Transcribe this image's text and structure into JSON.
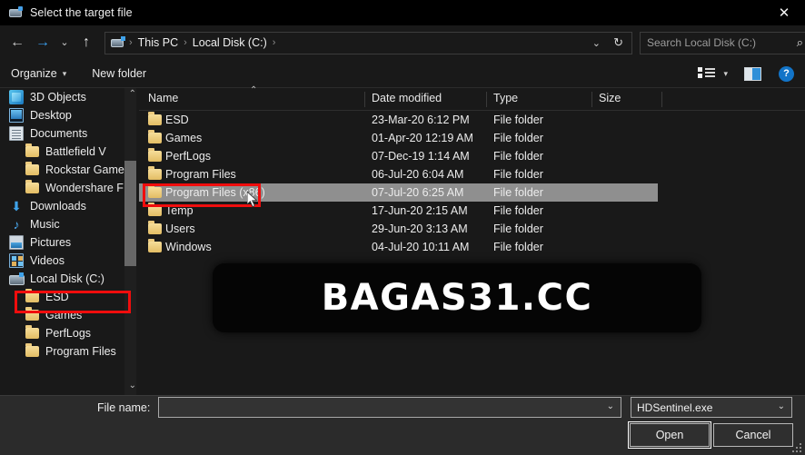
{
  "window": {
    "title": "Select the target file",
    "title_icon": "disk-drive-icon",
    "close_label": "✕"
  },
  "nav": {
    "back_label": "←",
    "forward_label": "→",
    "history_label": "⌄",
    "up_label": "↑",
    "refresh_label": "↻",
    "dropdown_label": "⌄"
  },
  "breadcrumb": {
    "icon": "disk-drive-icon",
    "items": [
      "This PC",
      "Local Disk (C:)"
    ],
    "separator": "›"
  },
  "search": {
    "placeholder": "Search Local Disk (C:)",
    "icon": "search-icon"
  },
  "commandbar": {
    "organize_label": "Organize",
    "organize_caret": "▾",
    "new_folder_label": "New folder",
    "view_caret": "▾",
    "help_label": "?"
  },
  "sidebar": {
    "scroll_up": "⌃",
    "scroll_down": "⌄",
    "items": [
      {
        "label": "3D Objects",
        "icon": "3d-objects-icon",
        "indent": 0,
        "type": "special"
      },
      {
        "label": "Desktop",
        "icon": "desktop-icon",
        "indent": 0,
        "type": "special"
      },
      {
        "label": "Documents",
        "icon": "documents-icon",
        "indent": 0,
        "type": "special"
      },
      {
        "label": "Battlefield V",
        "icon": "folder-icon",
        "indent": 1,
        "type": "folder"
      },
      {
        "label": "Rockstar Game",
        "icon": "folder-icon",
        "indent": 1,
        "type": "folder"
      },
      {
        "label": "Wondershare F",
        "icon": "folder-icon",
        "indent": 1,
        "type": "folder"
      },
      {
        "label": "Downloads",
        "icon": "downloads-icon",
        "indent": 0,
        "type": "special"
      },
      {
        "label": "Music",
        "icon": "music-icon",
        "indent": 0,
        "type": "special"
      },
      {
        "label": "Pictures",
        "icon": "pictures-icon",
        "indent": 0,
        "type": "special"
      },
      {
        "label": "Videos",
        "icon": "videos-icon",
        "indent": 0,
        "type": "special"
      },
      {
        "label": "Local Disk (C:)",
        "icon": "disk-drive-icon",
        "indent": 0,
        "type": "drive",
        "highlighted": true
      },
      {
        "label": "ESD",
        "icon": "folder-icon",
        "indent": 1,
        "type": "folder"
      },
      {
        "label": "Games",
        "icon": "folder-icon",
        "indent": 1,
        "type": "folder"
      },
      {
        "label": "PerfLogs",
        "icon": "folder-icon",
        "indent": 1,
        "type": "folder"
      },
      {
        "label": "Program Files",
        "icon": "folder-icon",
        "indent": 1,
        "type": "folder"
      }
    ]
  },
  "filelist": {
    "columns": [
      "Name",
      "Date modified",
      "Type",
      "Size"
    ],
    "sort_indicator": "⌃",
    "rows": [
      {
        "name": "ESD",
        "date": "23-Mar-20 6:12 PM",
        "type": "File folder",
        "size": "",
        "selected": false
      },
      {
        "name": "Games",
        "date": "01-Apr-20 12:19 AM",
        "type": "File folder",
        "size": "",
        "selected": false
      },
      {
        "name": "PerfLogs",
        "date": "07-Dec-19 1:14 AM",
        "type": "File folder",
        "size": "",
        "selected": false
      },
      {
        "name": "Program Files",
        "date": "06-Jul-20 6:04 AM",
        "type": "File folder",
        "size": "",
        "selected": false
      },
      {
        "name": "Program Files (x86)",
        "date": "07-Jul-20 6:25 AM",
        "type": "File folder",
        "size": "",
        "selected": true
      },
      {
        "name": "Temp",
        "date": "17-Jun-20 2:15 AM",
        "type": "File folder",
        "size": "",
        "selected": false
      },
      {
        "name": "Users",
        "date": "29-Jun-20 3:13 AM",
        "type": "File folder",
        "size": "",
        "selected": false
      },
      {
        "name": "Windows",
        "date": "04-Jul-20 10:11 AM",
        "type": "File folder",
        "size": "",
        "selected": false
      }
    ]
  },
  "watermark": {
    "text": "BAGAS31.CC"
  },
  "footer": {
    "file_name_label": "File name:",
    "file_name_value": "",
    "file_name_caret": "⌄",
    "file_type_value": "HDSentinel.exe",
    "file_type_caret": "⌄",
    "open_label": "Open",
    "cancel_label": "Cancel"
  },
  "colors": {
    "window_bg": "#191919",
    "titlebar_bg": "#000000",
    "footer_bg": "#2b2b2b",
    "selection": "#8f8f8f",
    "accent_blue": "#3aa0f0",
    "annotation_red": "#f00d0d",
    "folder_yellow": "#e3bd64"
  }
}
